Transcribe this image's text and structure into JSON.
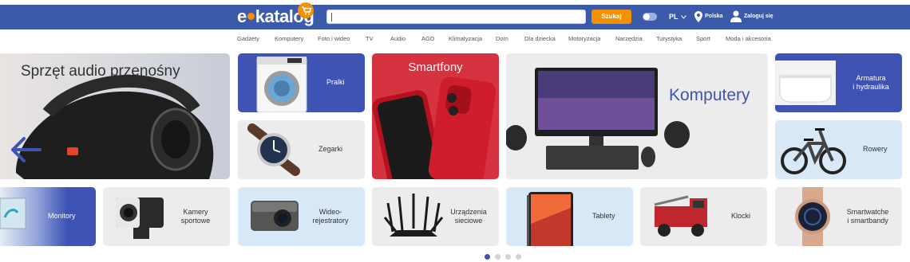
{
  "header": {
    "logo_text_left": "e",
    "logo_text_right": "katalog",
    "search_placeholder": "",
    "search_button": "Szukaj",
    "language": "PL",
    "country": "Polska",
    "login": "Zaloguj się"
  },
  "nav": {
    "items": [
      "Gadżety",
      "Komputery",
      "Foto i wideo",
      "TV",
      "Audio",
      "AGD",
      "Klimatyzacja",
      "Dom",
      "Dla dziecka",
      "Motoryzacja",
      "Narzędzia",
      "Turystyka",
      "Sport",
      "Moda i akcesoria"
    ]
  },
  "banner": {
    "title": "Sprzęt audio przenośny"
  },
  "tiles": {
    "pralki": "Pralki",
    "zegarki": "Zegarki",
    "smartfony": "Smartfony",
    "komputery": "Komputery",
    "armatura_l1": "Armatura",
    "armatura_l2": "i hydraulika",
    "rowery": "Rowery",
    "monitory": "Monitory",
    "kamery_l1": "Kamery",
    "kamery_l2": "sportowe",
    "wideo_l1": "Wideo-",
    "wideo_l2": "rejestratory",
    "urzadzenia_l1": "Urządzenia",
    "urzadzenia_l2": "sieciowe",
    "tablety": "Tablety",
    "klocki": "Klocki",
    "smartwatche_l1": "Smartwatche",
    "smartwatche_l2": "i smartbandy"
  },
  "colors": {
    "brand": "#3c5aaa",
    "accent": "#f39200",
    "tile_blue": "#3e53b4",
    "tile_red": "#d63340",
    "tile_grey": "#ececec",
    "tile_light": "#d9e8f6"
  },
  "carousel": {
    "pages": 4,
    "active_page": 1
  }
}
